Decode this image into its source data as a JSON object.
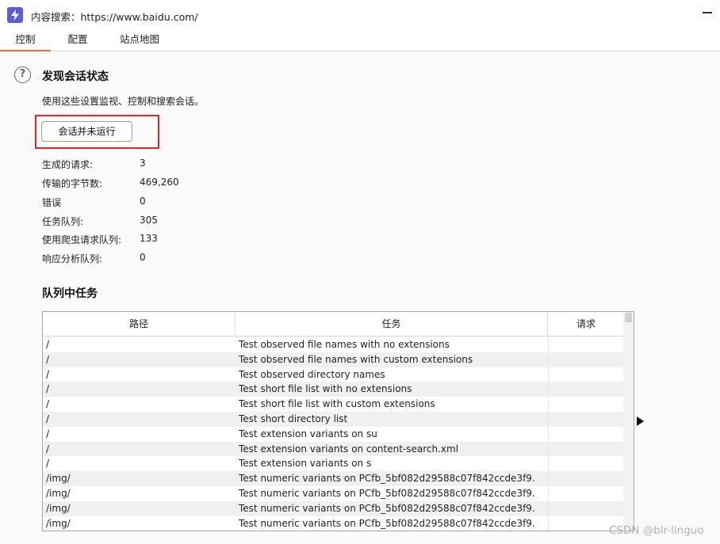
{
  "window": {
    "title": "内容搜索：https://www.baidu.com/"
  },
  "tabs": [
    {
      "label": "控制"
    },
    {
      "label": "配置"
    },
    {
      "label": "站点地图"
    }
  ],
  "status": {
    "heading": "发现会话状态",
    "description": "使用这些设置监视、控制和搜索会话。",
    "session_button": "会话并未运行"
  },
  "stats": [
    {
      "label": "生成的请求:",
      "value": "3"
    },
    {
      "label": "传输的字节数:",
      "value": "469,260"
    },
    {
      "label": "错误",
      "value": "0"
    },
    {
      "label": "任务队列:",
      "value": "305"
    },
    {
      "label": "使用爬虫请求队列:",
      "value": "133"
    },
    {
      "label": "响应分析队列:",
      "value": "0"
    }
  ],
  "queue": {
    "heading": "队列中任务",
    "columns": [
      "路径",
      "任务",
      "请求"
    ],
    "rows": [
      {
        "path": "/",
        "task": "Test observed file names with no extensions",
        "req": ""
      },
      {
        "path": "/",
        "task": "Test observed file names with custom extensions",
        "req": ""
      },
      {
        "path": "/",
        "task": "Test observed directory names",
        "req": ""
      },
      {
        "path": "/",
        "task": "Test short file list with no extensions",
        "req": ""
      },
      {
        "path": "/",
        "task": "Test short file list with custom extensions",
        "req": ""
      },
      {
        "path": "/",
        "task": "Test short directory list",
        "req": ""
      },
      {
        "path": "/",
        "task": "Test extension variants on su",
        "req": ""
      },
      {
        "path": "/",
        "task": "Test extension variants on content-search.xml",
        "req": ""
      },
      {
        "path": "/",
        "task": "Test extension variants on s",
        "req": ""
      },
      {
        "path": "/img/",
        "task": "Test numeric variants on PCfb_5bf082d29588c07f842ccde3f9.",
        "req": ""
      },
      {
        "path": "/img/",
        "task": "Test numeric variants on PCfb_5bf082d29588c07f842ccde3f9.",
        "req": ""
      },
      {
        "path": "/img/",
        "task": "Test numeric variants on PCfb_5bf082d29588c07f842ccde3f9.",
        "req": ""
      },
      {
        "path": "/img/",
        "task": "Test numeric variants on PCfb_5bf082d29588c07f842ccde3f9.",
        "req": ""
      }
    ]
  },
  "watermark": "CSDN @blr-linguo"
}
